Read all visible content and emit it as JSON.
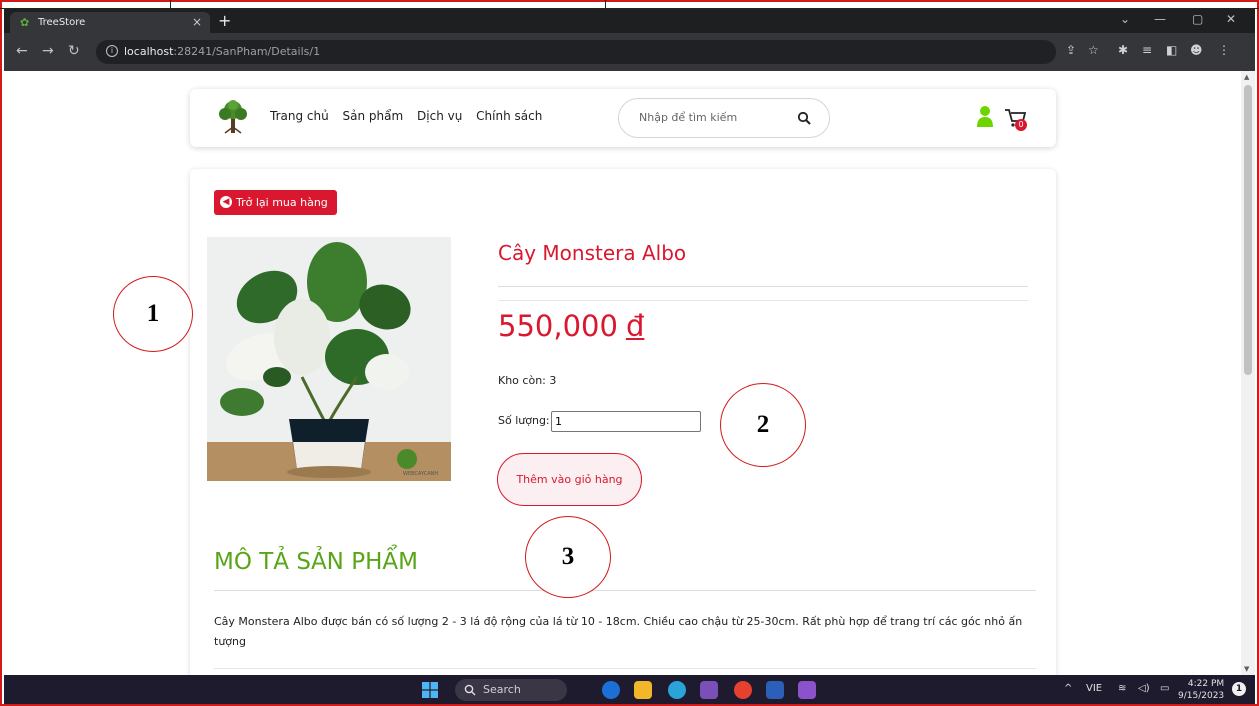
{
  "browser": {
    "tab_title": "TreeStore",
    "tab_close": "×",
    "new_tab": "+",
    "url_host": "localhost",
    "url_rest": ":28241/SanPham/Details/1"
  },
  "navbar": {
    "menu": [
      "Trang chủ",
      "Sản phẩm",
      "Dịch vụ",
      "Chính sách"
    ],
    "search_placeholder": "Nhập để tìm kiếm",
    "cart_count": "0"
  },
  "product": {
    "back_label": "Trở lại mua hàng",
    "name": "Cây Monstera Albo",
    "price": "550,000",
    "currency": "đ",
    "stock_label": "Kho còn: 3",
    "qty_label": "Số lượng:",
    "qty_value": "1",
    "add_to_cart": "Thêm vào giỏ hàng",
    "image_watermark": "WEBCAYCANH"
  },
  "description": {
    "heading": "MÔ TẢ SẢN PHẨM",
    "text": "Cây Monstera Albo được bán có số lượng 2 - 3 lá độ rộng của lá từ 10 - 18cm. Chiều cao chậu từ 25-30cm. Rất phù hợp để trang trí các góc nhỏ ấn tượng"
  },
  "annotations": [
    "1",
    "2",
    "3"
  ],
  "taskbar": {
    "search": "Search",
    "lang": "VIE",
    "time": "4:22 PM",
    "date": "9/15/2023",
    "notifications": "1"
  },
  "colors": {
    "accent_red": "#d9182f",
    "heading_green": "#58a618",
    "user_green": "#6dd400"
  }
}
